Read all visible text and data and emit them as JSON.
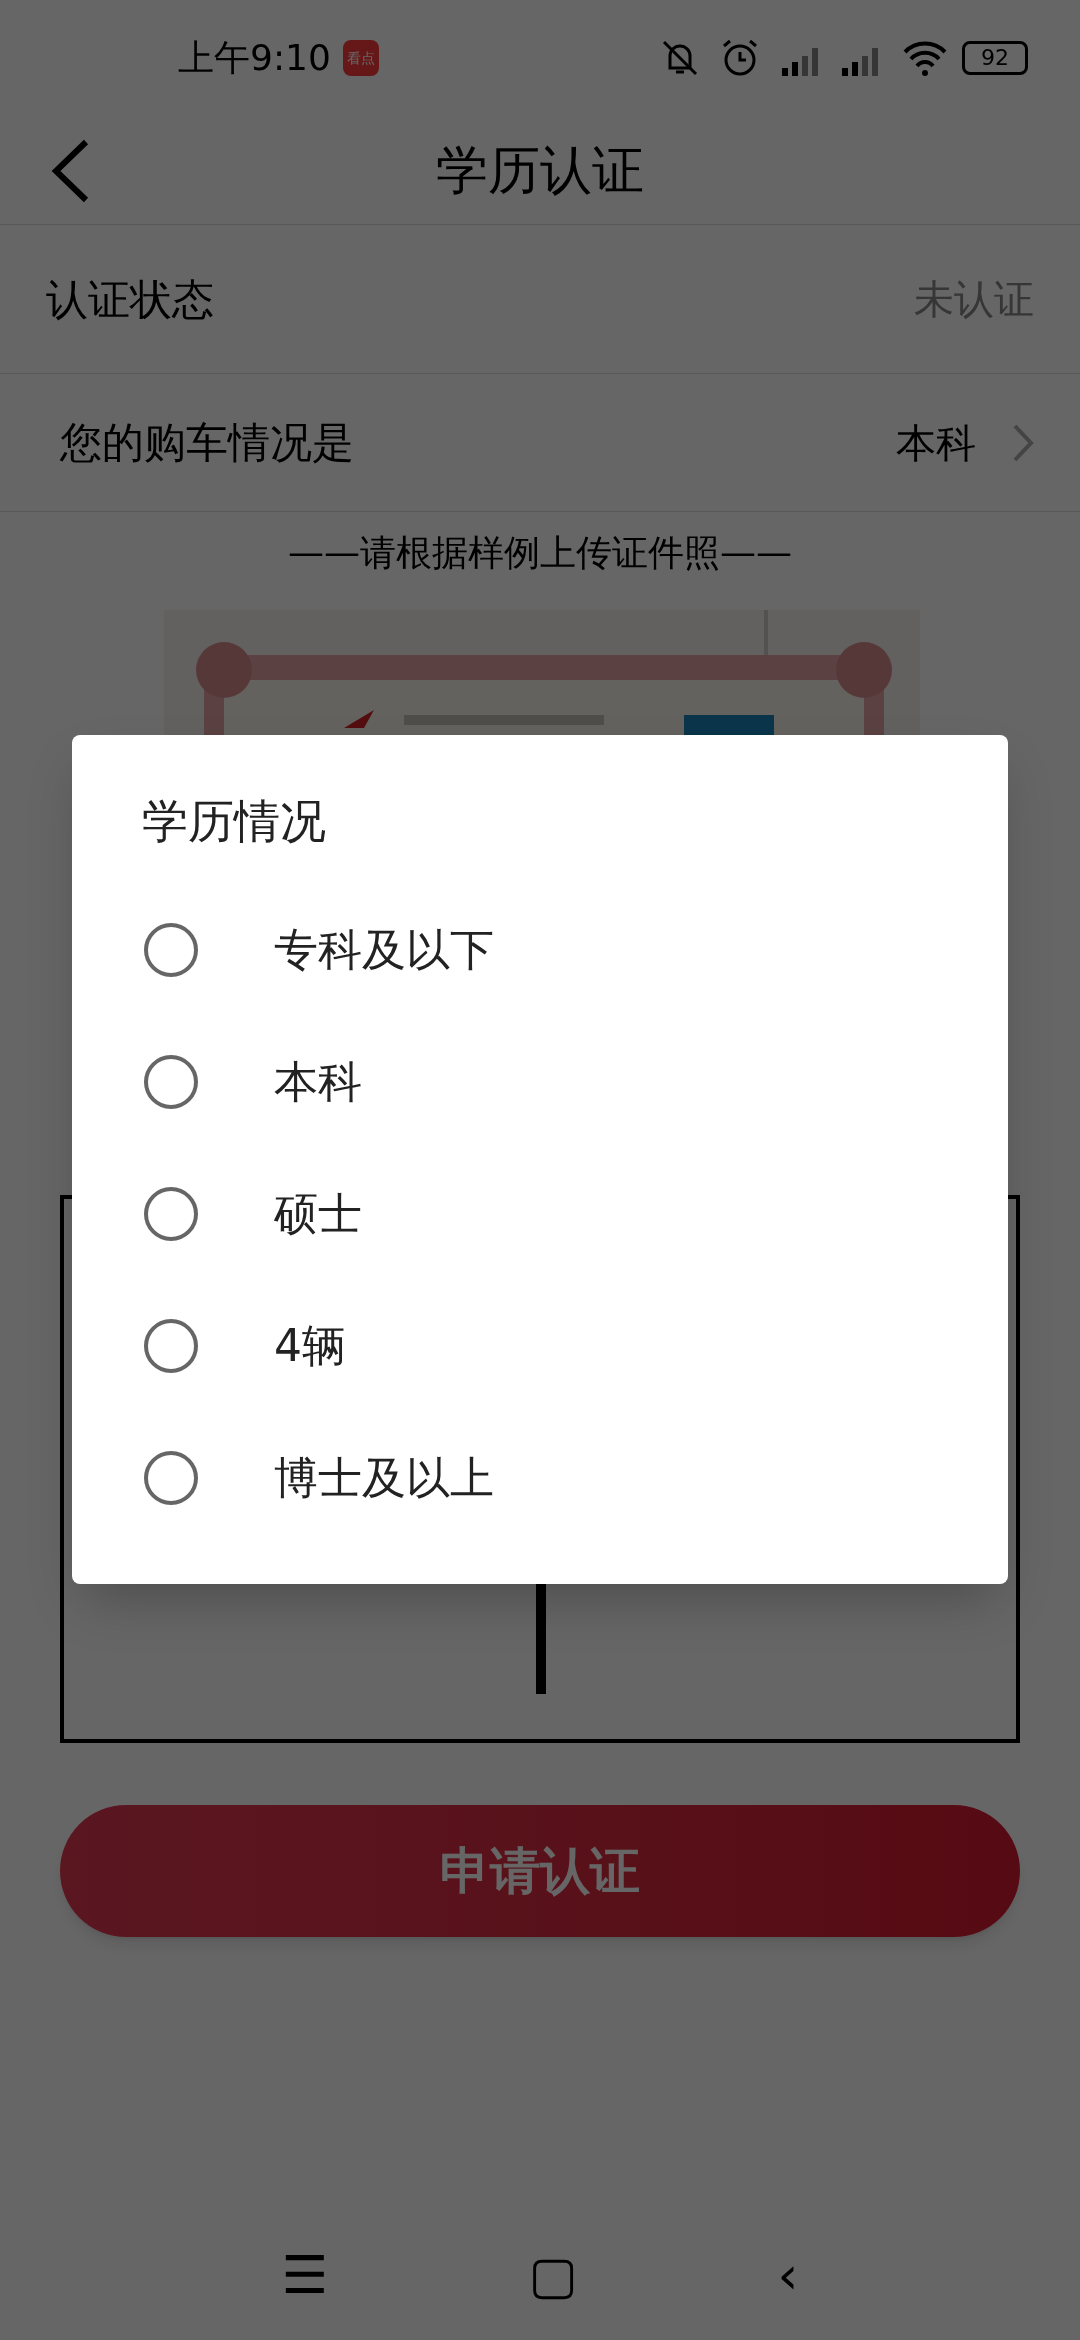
{
  "status_bar": {
    "time": "上午9:10",
    "app_badge": "看点",
    "battery": "92"
  },
  "header": {
    "title": "学历认证"
  },
  "rows": [
    {
      "label": "认证状态",
      "value": "未认证",
      "kind": "status"
    },
    {
      "label": "您的购车情况是",
      "value": "本科",
      "kind": "picker"
    }
  ],
  "instruction": "——请根据样例上传证件照——",
  "submit_button": "申请认证",
  "dialog": {
    "title": "学历情况",
    "options": [
      {
        "label": "专科及以下",
        "selected": false
      },
      {
        "label": "本科",
        "selected": false
      },
      {
        "label": "硕士",
        "selected": false
      },
      {
        "label": "4辆",
        "selected": false
      },
      {
        "label": "博士及以上",
        "selected": false
      }
    ]
  },
  "nav_bar": {
    "buttons": [
      "☰",
      "▢",
      "‹"
    ]
  }
}
